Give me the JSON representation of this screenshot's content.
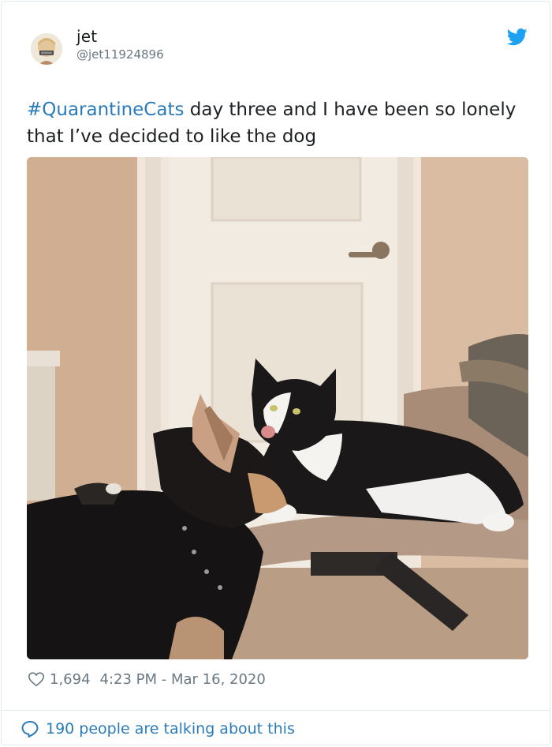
{
  "tweet": {
    "author_name": "jet",
    "author_handle": "@jet11924896",
    "hashtag": "#QuarantineCats",
    "text_rest": " day three and I have been so lonely that I’ve decided to like the dog",
    "likes": "1,694",
    "timestamp": "4:23 PM - Mar 16, 2020",
    "talking_text": "190 people are talking about this"
  },
  "icons": {
    "logo": "twitter-bird-icon",
    "like": "heart-icon",
    "talk": "speech-bubble-icon"
  },
  "colors": {
    "link": "#2b7bb9",
    "text": "#1c2022",
    "muted": "#697882",
    "brand": "#1da1f2"
  }
}
